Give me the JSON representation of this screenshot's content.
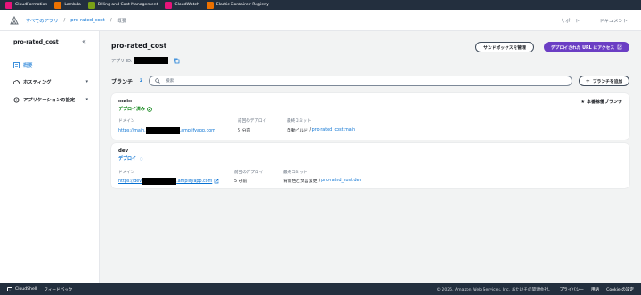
{
  "topbar": {
    "services": [
      {
        "label": "CloudFormation",
        "color": "#e7157b"
      },
      {
        "label": "Lambda",
        "color": "#ed7100"
      },
      {
        "label": "Billing and Cost Management",
        "color": "#7aa116"
      },
      {
        "label": "CloudWatch",
        "color": "#e7157b"
      },
      {
        "label": "Elastic Container Registry",
        "color": "#ed7100"
      }
    ]
  },
  "header": {
    "breadcrumb": {
      "root": "すべてのアプリ",
      "app": "pro-rated_cost",
      "current": "概要",
      "separator": "/"
    },
    "support": "サポート",
    "docs": "ドキュメント"
  },
  "sidebar": {
    "title": "pro-rated_cost",
    "collapse_icon": "double-chevron-left-icon",
    "items": [
      {
        "label": "概要",
        "icon": "overview-icon"
      },
      {
        "label": "ホスティング",
        "icon": "cloud-icon"
      },
      {
        "label": "アプリケーションの設定",
        "icon": "gear-icon"
      }
    ]
  },
  "main": {
    "title": "pro-rated_cost",
    "app_id_label": "アプリ ID:",
    "sandbox_button": "サンドボックスを管理",
    "visit_button": "デプロイされた URL にアクセス",
    "branches_label": "ブランチ",
    "branches_count": "2",
    "search_placeholder": "検索",
    "add_branch_button": "ブランチを追加",
    "accent": "#6b3ec4",
    "link_color": "#0972d3",
    "status_green": "#037f0c"
  },
  "branches": [
    {
      "name": "main",
      "status": "デプロイ済み",
      "prod_tag": "本番稼働ブランチ",
      "domain_label": "ドメイン",
      "domain_prefix": "https://main.",
      "domain_suffix": ".amplifyapp.com",
      "last_deploy_label": "前回のデプロイ",
      "last_deploy": "5 分前",
      "last_commit_label": "最終コミット",
      "commit_msg": "自動ビルド",
      "commit_sep": " / ",
      "commit_ref": "pro-rated_cost:main"
    },
    {
      "name": "dev",
      "status": "デプロイ",
      "domain_label": "ドメイン",
      "domain_prefix": "https://dev.",
      "domain_suffix": ".amplifyapp.com",
      "last_deploy_label": "前回のデプロイ",
      "last_deploy": "5 分前",
      "last_commit_label": "最終コミット",
      "commit_msg": "背景色と文言変更",
      "commit_sep": " / ",
      "commit_ref": "pro-rated_cost:dev"
    }
  ],
  "footer": {
    "cloudshell": "CloudShell",
    "feedback": "フィードバック",
    "copyright": "© 2025, Amazon Web Services, Inc. またはその関連会社。",
    "privacy": "プライバシー",
    "terms": "用語",
    "cookie": "Cookie の設定"
  }
}
